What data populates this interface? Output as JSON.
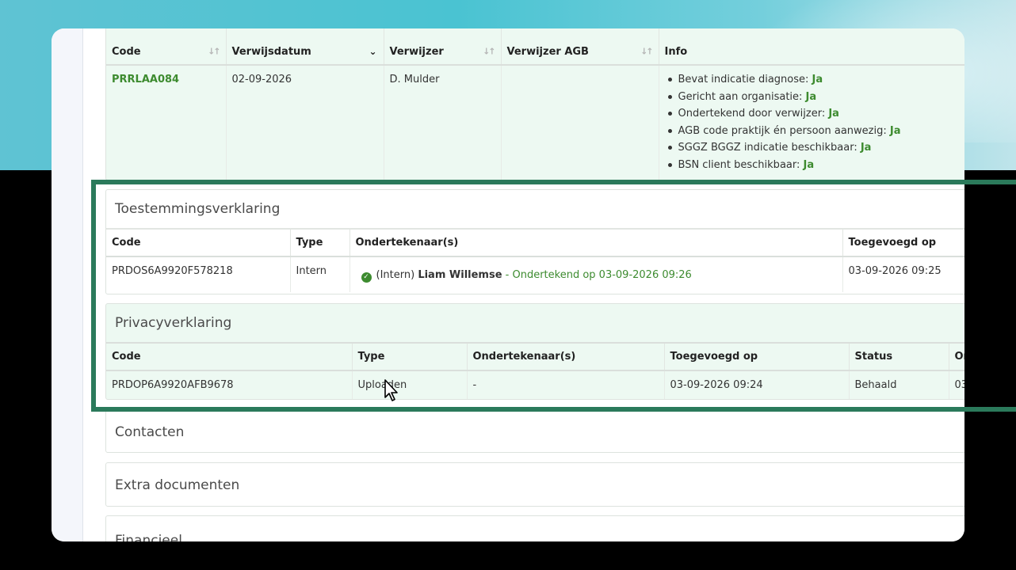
{
  "referral": {
    "headers": [
      "Code",
      "Verwijsdatum",
      "Verwijzer",
      "Verwijzer AGB",
      "Info"
    ],
    "row": {
      "code": "PRRLAA084",
      "date": "02-09-2026",
      "referrer": "D. Mulder",
      "agb": ""
    },
    "info": [
      {
        "label": "Bevat indicatie diagnose: ",
        "value": "Ja"
      },
      {
        "label": "Gericht aan organisatie: ",
        "value": "Ja"
      },
      {
        "label": "Ondertekend door verwijzer: ",
        "value": "Ja"
      },
      {
        "label": "AGB code praktijk én persoon aanwezig: ",
        "value": "Ja"
      },
      {
        "label": "SGGZ BGGZ indicatie beschikbaar: ",
        "value": "Ja"
      },
      {
        "label": "BSN client beschikbaar: ",
        "value": "Ja"
      }
    ]
  },
  "consent": {
    "title": "Toestemmingsverklaring",
    "headers": [
      "Code",
      "Type",
      "Ondertekenaar(s)",
      "Toegevoegd op"
    ],
    "row": {
      "code": "PRDOS6A9920F578218",
      "type": "Intern",
      "signer_prefix": "(Intern) ",
      "signer_name": "Liam Willemse",
      "signed": " - Ondertekend op 03-09-2026 09:26",
      "added": "03-09-2026 09:25"
    }
  },
  "privacy": {
    "title": "Privacyverklaring",
    "headers": [
      "Code",
      "Type",
      "Ondertekenaar(s)",
      "Toegevoegd op",
      "Status",
      "Ondertekend op"
    ],
    "row": {
      "code": "PRDOP6A9920AFB9678",
      "type": "Uploaden",
      "signers": "-",
      "added": "03-09-2026 09:24",
      "status": "Behaald",
      "signed": "03"
    }
  },
  "sections": {
    "contacts": "Contacten",
    "documents": "Extra documenten",
    "financial": "Financieel"
  },
  "colors": {
    "highlight": "#2b7a5b",
    "accent_green": "#3d8b2f",
    "panel_green": "#edf9f2"
  }
}
